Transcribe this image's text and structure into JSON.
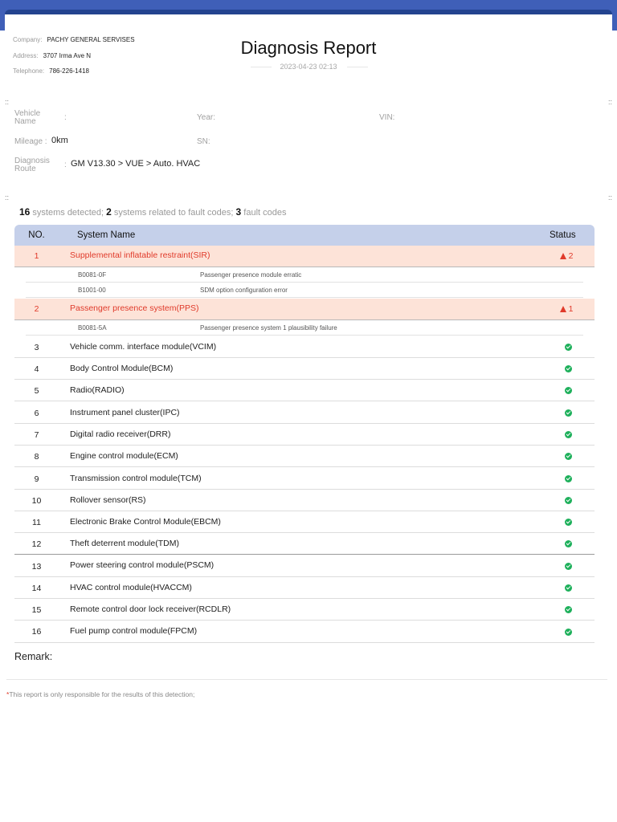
{
  "company": {
    "company_label": "Company:",
    "company_value": "PACHY GENERAL SERVISES",
    "address_label": "Address:",
    "address_value": "3707 Irma Ave N",
    "telephone_label": "Telephone:",
    "telephone_value": "786-226-1418"
  },
  "report": {
    "title": "Diagnosis Report",
    "datetime": "2023-04-23 02:13"
  },
  "separator_glyph": "::",
  "vehicle": {
    "name_label": "Vehicle Name",
    "name_value": "",
    "year_label": "Year:",
    "vin_label": "VIN:",
    "mileage_label": "Mileage :",
    "mileage_value": "0km",
    "sn_label": "SN:",
    "route_label": "Diagnosis Route",
    "route_value": "GM V13.30 > VUE > Auto. HVAC",
    "colon": ":"
  },
  "summary": {
    "systems_count": "16",
    "systems_text": "systems detected;",
    "related_count": "2",
    "related_text": "systems related to fault codes;",
    "codes_count": "3",
    "codes_text": "fault codes"
  },
  "table": {
    "headers": {
      "no": "NO.",
      "name": "System Name",
      "status": "Status"
    },
    "fault_rows": [
      {
        "no": "1",
        "name": "Supplemental inflatable restraint(SIR)",
        "status": "2",
        "codes": [
          {
            "code": "B0081-0F",
            "desc": "Passenger presence module erratic"
          },
          {
            "code": "B1001-00",
            "desc": "SDM option configuration error"
          }
        ]
      },
      {
        "no": "2",
        "name": "Passenger presence system(PPS)",
        "status": "1",
        "codes": [
          {
            "code": "B0081-5A",
            "desc": "Passenger presence system 1 plausibility failure"
          }
        ]
      }
    ],
    "ok_rows": [
      {
        "no": "3",
        "name": "Vehicle comm. interface module(VCIM)"
      },
      {
        "no": "4",
        "name": "Body Control Module(BCM)"
      },
      {
        "no": "5",
        "name": "Radio(RADIO)"
      },
      {
        "no": "6",
        "name": "Instrument panel cluster(IPC)"
      },
      {
        "no": "7",
        "name": "Digital radio receiver(DRR)"
      },
      {
        "no": "8",
        "name": "Engine control module(ECM)"
      },
      {
        "no": "9",
        "name": "Transmission control module(TCM)"
      },
      {
        "no": "10",
        "name": "Rollover sensor(RS)"
      },
      {
        "no": "11",
        "name": "Electronic Brake Control Module(EBCM)"
      },
      {
        "no": "12",
        "name": "Theft deterrent module(TDM)"
      },
      {
        "no": "13",
        "name": "Power steering control module(PSCM)"
      },
      {
        "no": "14",
        "name": "HVAC control module(HVACCM)"
      },
      {
        "no": "15",
        "name": "Remote control door lock receiver(RCDLR)"
      },
      {
        "no": "16",
        "name": "Fuel pump control module(FPCM)"
      }
    ]
  },
  "remark_label": "Remark:",
  "footnote": {
    "star": "*",
    "text": "This report is only responsible for the results of this detection;"
  },
  "colors": {
    "header_band": "#3f5fb8",
    "table_header": "#c5d0ea",
    "fault_row_bg": "#fde3d8",
    "fault_text": "#e03a2a",
    "ok_icon": "#1eb05b"
  }
}
